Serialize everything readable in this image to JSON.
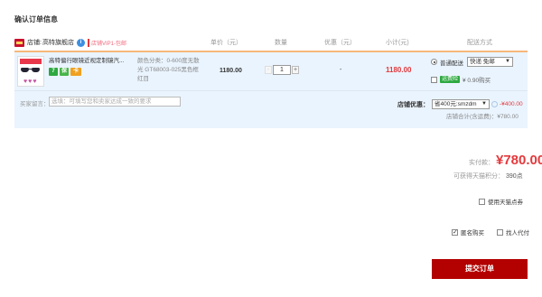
{
  "page_title": "确认订单信息",
  "shop": {
    "label": "店铺:",
    "name": "高特旗舰店",
    "info_icon": "info-icon",
    "vip_text": "店铺VIP1-包邮"
  },
  "columns": {
    "unit_price": "单价（元）",
    "quantity": "数量",
    "discount": "优惠（元）",
    "subtotal": "小计(元)",
    "shipping": "配送方式"
  },
  "item": {
    "title": "高特偏行眼镜近视定制镜汽...",
    "badges": [
      "7",
      "保",
      "卡"
    ],
    "sku_lines": [
      "颜色分类：0-600度无散",
      "光 GT68003-025黑色框",
      "红目"
    ],
    "unit_price": "1180.00",
    "qty_minus": "-",
    "qty_value": "1",
    "qty_plus": "+",
    "discount": "-",
    "subtotal": "1180.00",
    "shipping_label": "普通配送",
    "shipping_select": "快递 免邮",
    "insurance_badge": "运费险",
    "insurance_text": "¥ 0.90购买"
  },
  "message": {
    "label": "买家留言：",
    "placeholder": "选填：可填写您和卖家达成一致的要求"
  },
  "shop_coupon": {
    "label": "店铺优惠：",
    "select": "省400元:smzdm",
    "amount": "-¥400.00",
    "total_text": "店铺合计(含运费)：¥780.00"
  },
  "payment": {
    "label": "实付款：",
    "amount": "¥780.00",
    "points_text": "可获得天猫积分：",
    "points_value": "390点"
  },
  "options": {
    "coupon_use": "使用天猫点券",
    "anonymous": "匿名购买",
    "proxy": "找人代付"
  },
  "submit_label": "提交订单"
}
